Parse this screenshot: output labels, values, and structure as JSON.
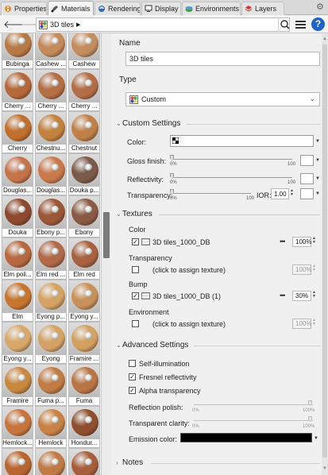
{
  "tabs": [
    {
      "label": "Properties",
      "icon": "properties-icon"
    },
    {
      "label": "Materials",
      "icon": "materials-icon",
      "active": true
    },
    {
      "label": "Rendering",
      "icon": "rendering-icon"
    },
    {
      "label": "Display",
      "icon": "display-icon"
    },
    {
      "label": "Environments",
      "icon": "environments-icon"
    },
    {
      "label": "Layers",
      "icon": "layers-icon"
    }
  ],
  "toolbar": {
    "breadcrumb": "3D tiles",
    "help": "?"
  },
  "library": [
    {
      "label": "Bubinga",
      "color": "#b87a45"
    },
    {
      "label": "Cashew ...",
      "color": "#c58a5a"
    },
    {
      "label": "Cashew",
      "color": "#c48d5f"
    },
    {
      "label": "Cherry ...",
      "color": "#b5693a"
    },
    {
      "label": "Cherry ...",
      "color": "#b46f45"
    },
    {
      "label": "Cherry ...",
      "color": "#b36e48"
    },
    {
      "label": "Cherry",
      "color": "#c06f2c"
    },
    {
      "label": "Chestnu...",
      "color": "#c3813e"
    },
    {
      "label": "Chestnut",
      "color": "#c08048"
    },
    {
      "label": "Douglas...",
      "color": "#c6734a"
    },
    {
      "label": "Douglas...",
      "color": "#c97a4c"
    },
    {
      "label": "Douka p...",
      "color": "#7b5a4a"
    },
    {
      "label": "Douka",
      "color": "#8e4a2d"
    },
    {
      "label": "Ebony p...",
      "color": "#9b5736"
    },
    {
      "label": "Ebony",
      "color": "#8a5a44"
    },
    {
      "label": "Elm poli...",
      "color": "#b8683e"
    },
    {
      "label": "Elm red ...",
      "color": "#b06a48"
    },
    {
      "label": "Elm red",
      "color": "#a8623f"
    },
    {
      "label": "Elm",
      "color": "#c6762f"
    },
    {
      "label": "Eyong p...",
      "color": "#d4a363"
    },
    {
      "label": "Eyong y...",
      "color": "#c9915a"
    },
    {
      "label": "Eyong y...",
      "color": "#d7a86a"
    },
    {
      "label": "Eyong",
      "color": "#d5a266"
    },
    {
      "label": "Framire ...",
      "color": "#d2a060"
    },
    {
      "label": "Framire",
      "color": "#c8883f"
    },
    {
      "label": "Fuma p...",
      "color": "#c27c45"
    },
    {
      "label": "Fuma",
      "color": "#b97545"
    },
    {
      "label": "Hemlock...",
      "color": "#c7753c"
    },
    {
      "label": "Hemlock",
      "color": "#c98245"
    },
    {
      "label": "Hondur...",
      "color": "#8e4f2e"
    },
    {
      "label": "",
      "color": "#b9652f"
    },
    {
      "label": "",
      "color": "#c27a45"
    },
    {
      "label": "",
      "color": "#a85e3a"
    }
  ],
  "props": {
    "name_label": "Name",
    "name_value": "3D tiles",
    "type_label": "Type",
    "type_value": "Custom",
    "custom_settings": "Custom Settings",
    "color_label": "Color:",
    "gloss_label": "Gloss finish:",
    "reflectivity_label": "Reflectivity:",
    "transparency_label": "Transparency:",
    "tick_0": "0%",
    "tick_100": "100",
    "ior_label": "IOR:",
    "ior_value": "1.00",
    "gloss_value": 0.0,
    "reflectivity_value": 0.0,
    "transparency_value": 0.0,
    "textures": "Textures",
    "tex_color_label": "Color",
    "tex_color_name": "3D tiles_1000_DB",
    "tex_color_amount": "100%",
    "tex_color_checked": true,
    "tex_transparency_label": "Transparency",
    "tex_transparency_name": "(click to assign texture)",
    "tex_transparency_amount": "100%",
    "tex_bump_label": "Bump",
    "tex_bump_name": "3D tiles_1000_DB (1)",
    "tex_bump_amount": "30%",
    "tex_bump_checked": true,
    "tex_environment_label": "Environment",
    "tex_environment_name": "(click to assign texture)",
    "tex_environment_amount": "100%",
    "advanced": "Advanced Settings",
    "self_illumination": "Self-illumination",
    "fresnel": "Fresnel reflectivity",
    "alpha_transparency": "Alpha transparency",
    "reflection_polish": "Reflection polish:",
    "transparent_clarity": "Transparent clarity:",
    "tick_0_short": "0%",
    "tick_100_pct": "100%",
    "emission_label": "Emission color:",
    "emission_color": "#000000",
    "notes": "Notes"
  },
  "colors": {
    "help_blue": "#1c64c8"
  }
}
